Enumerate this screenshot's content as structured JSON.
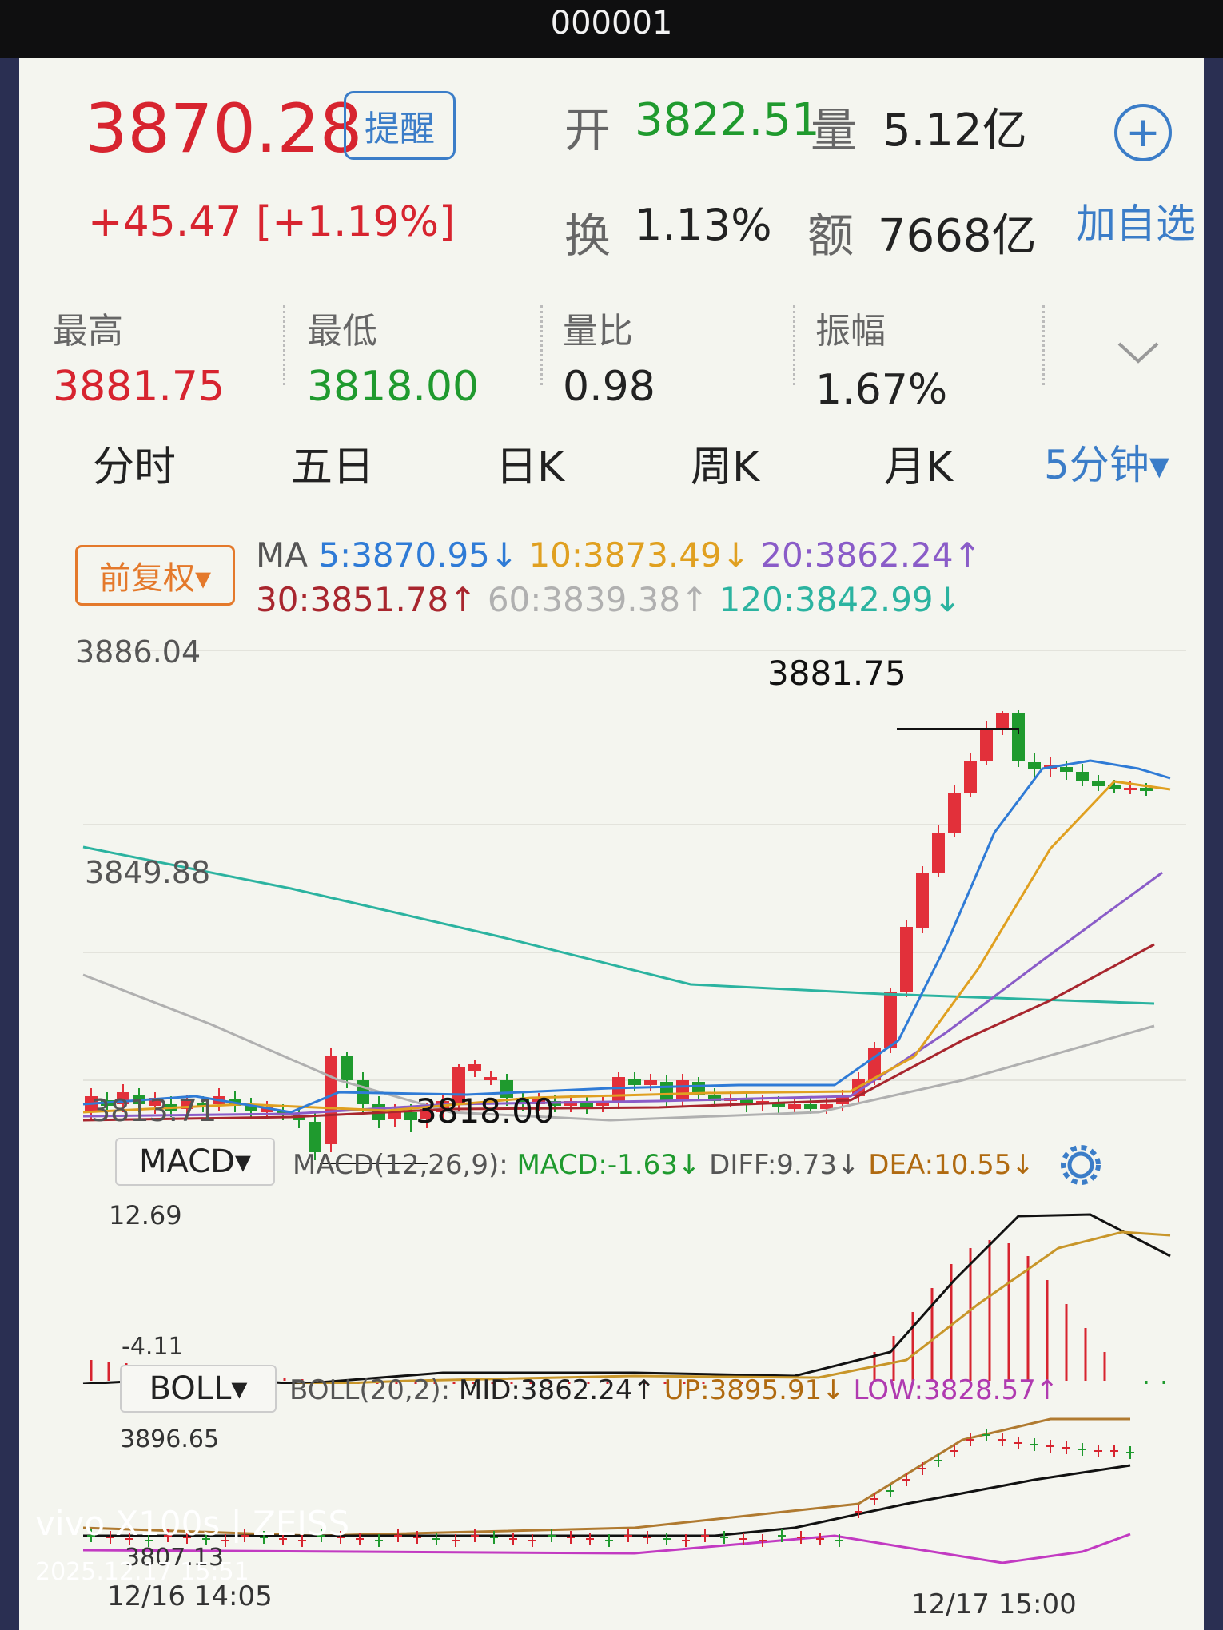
{
  "top": {
    "code": "000001"
  },
  "quote": {
    "price": "3870.28",
    "remind_label": "提醒",
    "change": "+45.47",
    "change_pct": "[+1.19%]",
    "open_label": "开",
    "open_value": "3822.51",
    "volume_label": "量",
    "volume_value": "5.12亿",
    "turnover_label": "换",
    "turnover_value": "1.13%",
    "amount_label": "额",
    "amount_value": "7668亿",
    "add_watch_label": "加自选"
  },
  "stats": [
    {
      "label": "最高",
      "value": "3881.75",
      "color": "#d7242f"
    },
    {
      "label": "最低",
      "value": "3818.00",
      "color": "#1f9a2e"
    },
    {
      "label": "量比",
      "value": "0.98",
      "color": "#222222"
    },
    {
      "label": "振幅",
      "value": "1.67%",
      "color": "#222222"
    }
  ],
  "tabs": [
    "分时",
    "五日",
    "日K",
    "周K",
    "月K",
    "5分钟▾"
  ],
  "adjust_label": "前复权▾",
  "ma": {
    "prefix": "MA",
    "ma5": "5:3870.95↓",
    "ma10": "10:3873.49↓",
    "ma20": "20:3862.24↑",
    "ma30": "30:3851.78↑",
    "ma60": "60:3839.38↑",
    "ma120": "120:3842.99↓",
    "colors": {
      "ma5": "#2f7bd6",
      "ma10": "#e0a020",
      "ma20": "#8a5cc8",
      "ma30": "#a8262e",
      "ma60": "#b0b0b0",
      "ma120": "#2bb3a0"
    }
  },
  "main_chart": {
    "y_top": "3886.04",
    "y_mid": "3849.88",
    "y_bot": "3813.71",
    "high_marker": "3881.75",
    "low_marker": "3818.00"
  },
  "macd": {
    "button": "MACD▾",
    "params": "MACD(12,26,9):",
    "macd": "MACD:-1.63↓",
    "diff": "DIFF:9.73↓",
    "dea": "DEA:10.55↓",
    "y_top": "12.69",
    "y_bot": "-4.11"
  },
  "boll": {
    "button": "BOLL▾",
    "params": "BOLL(20,2):",
    "mid": "MID:3862.24↑",
    "up": "UP:3895.91↓",
    "low": "LOW:3828.57↑",
    "y_top": "3896.65",
    "y_bot": "3807.13"
  },
  "time_axis": {
    "start": "12/16 14:05",
    "end": "12/17 15:00"
  },
  "watermark": {
    "brand": "vivo X100s | ZEISS",
    "datetime": "2025.12.17 15:51"
  }
}
